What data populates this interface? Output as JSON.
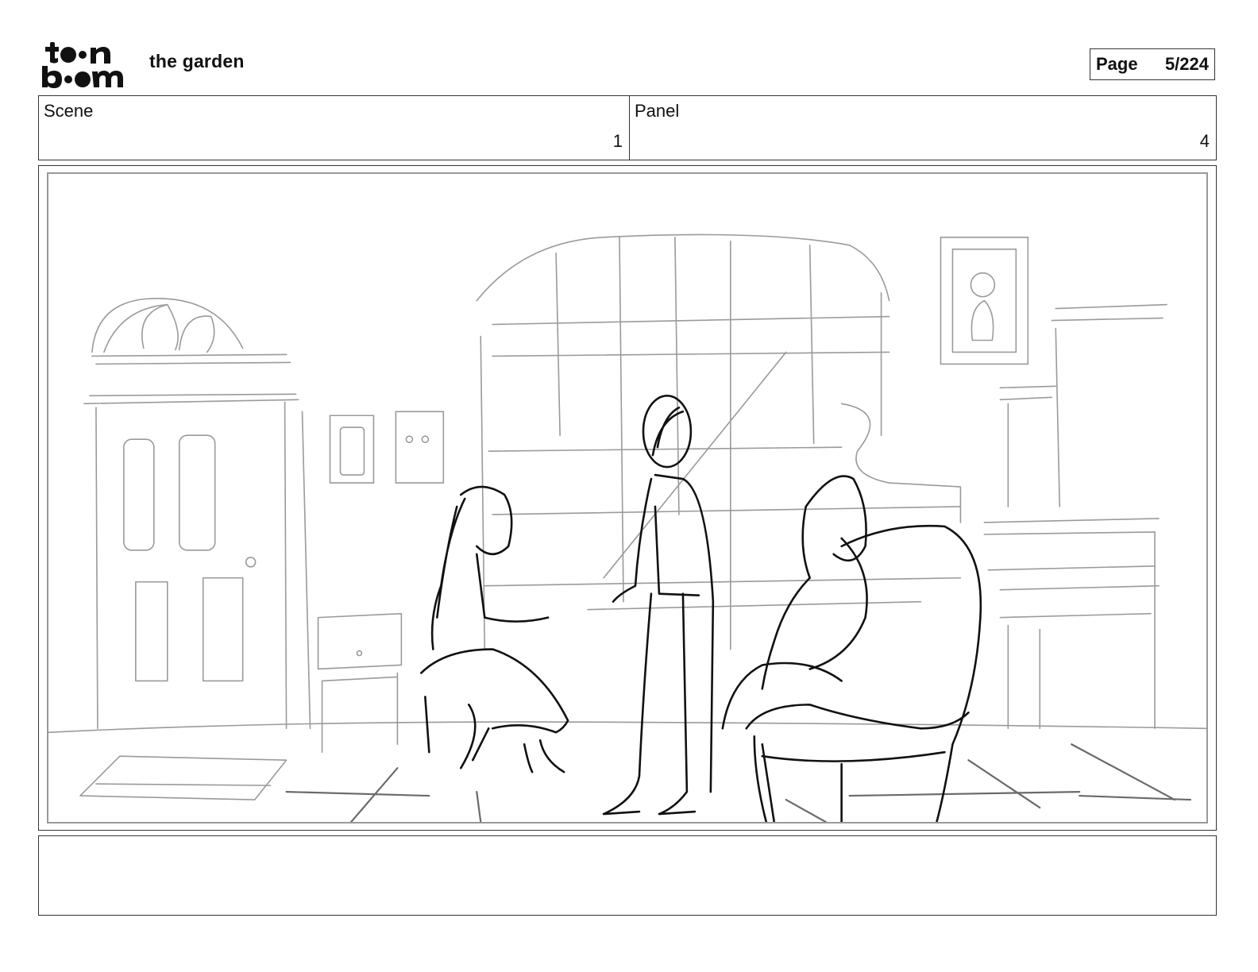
{
  "header": {
    "logo_lines": [
      "toon",
      "boom"
    ],
    "project_title": "the garden",
    "page_label": "Page",
    "page_value": "5/224"
  },
  "info": {
    "scene_label": "Scene",
    "scene_value": "1",
    "panel_label": "Panel",
    "panel_value": "4"
  },
  "panel": {
    "drawing": "rough pencil sketch"
  },
  "notes": {
    "text": ""
  }
}
